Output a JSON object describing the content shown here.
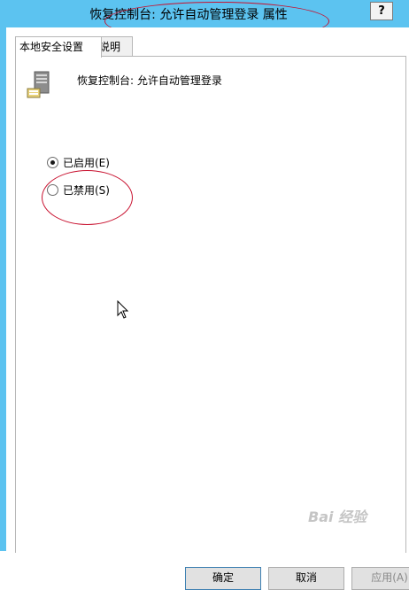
{
  "window": {
    "title": "恢复控制台: 允许自动管理登录 属性",
    "help_label": "?"
  },
  "tabs": [
    {
      "label": "本地安全设置",
      "active": true
    },
    {
      "label": "说明",
      "active": false
    }
  ],
  "policy": {
    "icon": "server-policy-icon",
    "name": "恢复控制台: 允许自动管理登录"
  },
  "options": [
    {
      "label": "已启用(E)",
      "checked": true
    },
    {
      "label": "已禁用(S)",
      "checked": false
    }
  ],
  "buttons": {
    "ok": "确定",
    "cancel": "取消",
    "apply": "应用(A)"
  },
  "watermark": "Bai 经验",
  "colors": {
    "titlebar": "#5cc3f0",
    "annotation": "#c8102e"
  }
}
